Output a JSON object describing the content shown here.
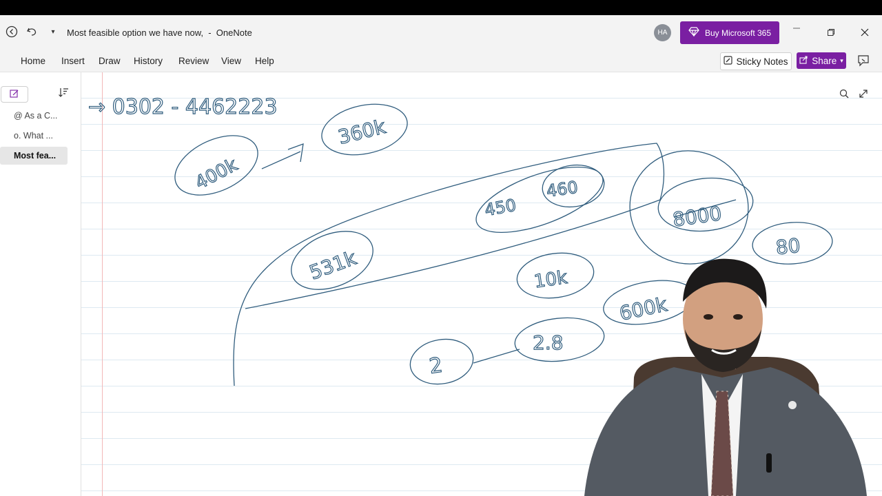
{
  "titlebar": {
    "document_title": "Most feasible option we have now,  -  OneNote",
    "avatar_initials": "HA",
    "buy_label": "Buy Microsoft 365"
  },
  "menu": {
    "items": [
      "Home",
      "Insert",
      "Draw",
      "History",
      "Review",
      "View",
      "Help"
    ],
    "sticky_notes_label": "Sticky Notes",
    "share_label": "Share"
  },
  "sidebar": {
    "pages": [
      {
        "label": "@ As a C..."
      },
      {
        "label": "o. What ..."
      },
      {
        "label": "Most fea..."
      }
    ]
  },
  "notes": {
    "phone": "→ 0302 - 4462223",
    "bubbles": [
      "400k",
      "360k",
      "450",
      "460",
      "531k",
      "8000",
      "80",
      "10k",
      "600k",
      "2",
      "2.8"
    ]
  },
  "colors": {
    "accent": "#7a1fa2",
    "ink": "#2f5c7d",
    "ruled_line": "#dde9f1",
    "margin_line": "#f2b8b8"
  }
}
